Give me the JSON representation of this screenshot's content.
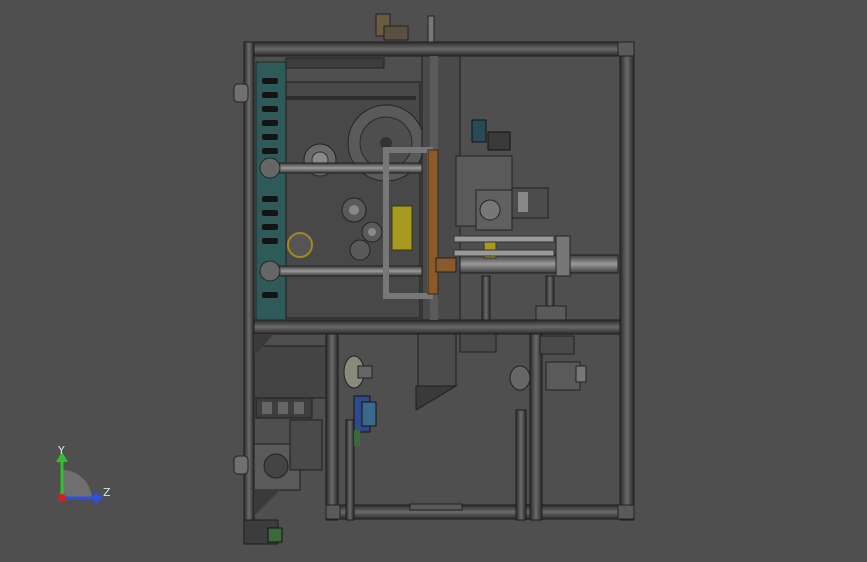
{
  "viewport": {
    "background": "#4f4f4f"
  },
  "triad": {
    "y_label": "Y",
    "z_label": "Z",
    "y_color": "#2fbf2f",
    "z_color": "#2f4fdf",
    "origin_color": "#d02020"
  },
  "model": {
    "frame_color": "#3a3a3a",
    "panel_color": "#2f5f5f",
    "accent_yellow": "#b5a020",
    "accent_blue": "#3050a0",
    "accent_green": "#3a7a3a"
  }
}
